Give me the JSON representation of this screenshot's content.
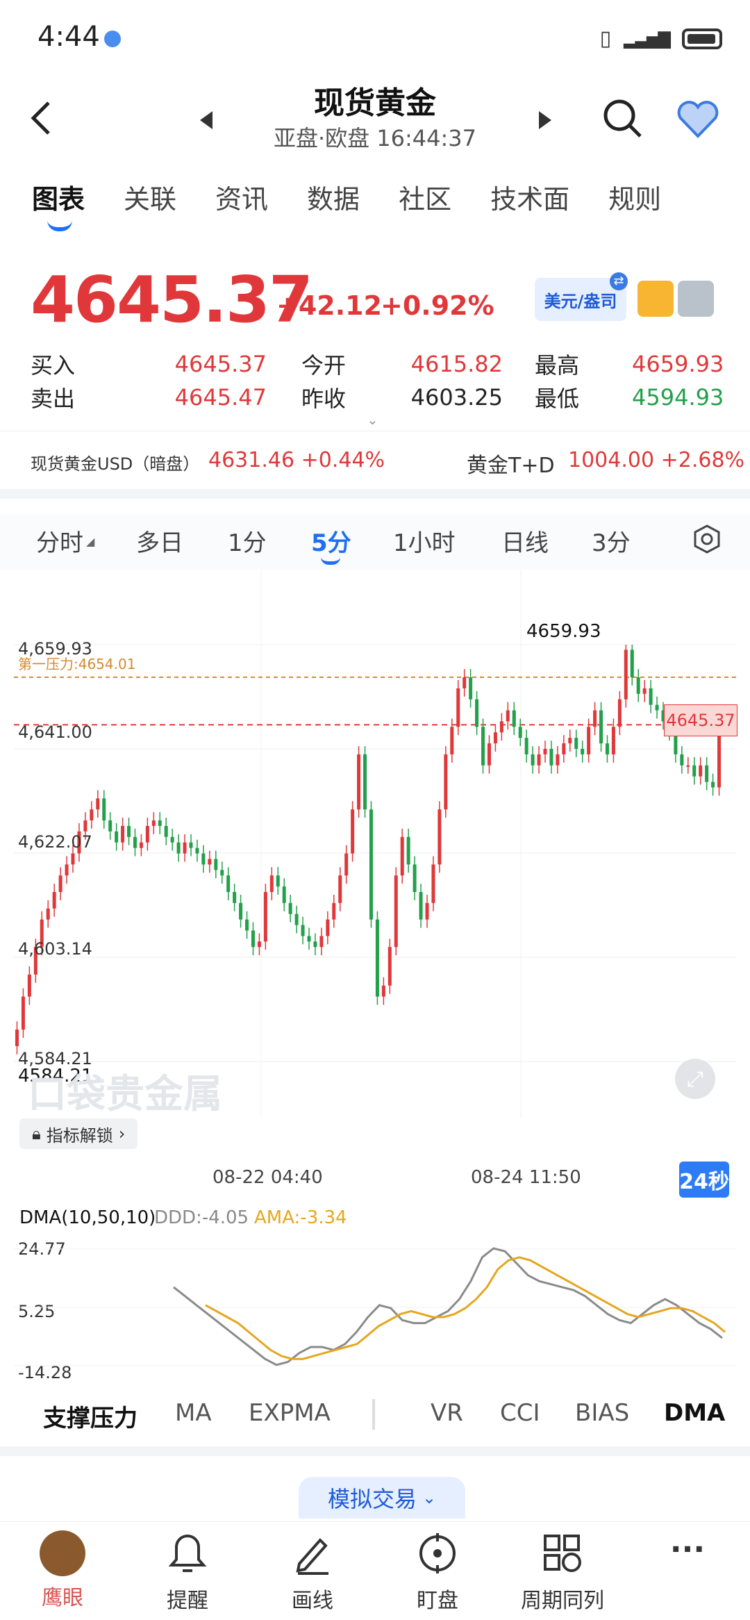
{
  "status": {
    "time": "4:44"
  },
  "header": {
    "title": "现货黄金",
    "subtitle": "亚盘·欧盘   16:44:37"
  },
  "tabs": [
    "图表",
    "关联",
    "资讯",
    "数据",
    "社区",
    "技术面",
    "规则"
  ],
  "quote": {
    "price": "4645.37",
    "change": "+42.12",
    "change_pct": "+0.92%",
    "currency_btn": "美元/盎司",
    "rows": [
      [
        "买入",
        "4645.37",
        "今开",
        "4615.82",
        "最高",
        "4659.93"
      ],
      [
        "卖出",
        "4645.47",
        "昨收",
        "4603.25",
        "最低",
        "4594.93"
      ]
    ]
  },
  "sub_quotes": {
    "left_label": "现货黄金USD（暗盘）",
    "left_value": "4631.46 +0.44%",
    "right_label": "黄金T+D",
    "right_value": "1004.00 +2.68%"
  },
  "periods": [
    "分时",
    "多日",
    "1分",
    "5分",
    "1小时",
    "日线",
    "3分"
  ],
  "active_period": "5分",
  "chart_labels": {
    "y_ticks": [
      "4,659.93",
      "4,641.00",
      "4,622.07",
      "4,603.14",
      "4,584.21"
    ],
    "resistance": "第一压力:4654.01",
    "high_marker": "4659.93",
    "low_marker": "4584.21",
    "current_tag": "4645.37",
    "unlock": "指标解锁",
    "x_ticks": [
      "08-22 04:40",
      "08-24 11:50"
    ],
    "countdown": "24秒",
    "watermark": "口袋贵金属"
  },
  "dma_panel": {
    "title": "DMA(10,50,10)",
    "ddd": "DDD:-4.05",
    "ama": "AMA:-3.34",
    "y_ticks": [
      "24.77",
      "5.25",
      "-14.28"
    ]
  },
  "indicator_tabs": [
    "支撑压力",
    "MA",
    "EXPMA",
    "VR",
    "CCI",
    "BIAS",
    "DMA"
  ],
  "sim_trade": "模拟交易",
  "bottom_nav": [
    "鹰眼",
    "提醒",
    "画线",
    "盯盘",
    "周期同列",
    "···"
  ],
  "colors": {
    "up": "#e0383a",
    "down": "#22a04a",
    "accent": "#1e6ff5"
  },
  "chart_data": {
    "type": "candlestick",
    "ylim": [
      4584.21,
      4659.93
    ],
    "resistance_level": 4654.01,
    "current_price": 4645.37,
    "close_series": [
      4590,
      4596,
      4600,
      4605,
      4610,
      4612,
      4615,
      4618,
      4620,
      4622,
      4626,
      4628,
      4630,
      4632,
      4628,
      4626,
      4624,
      4627,
      4625,
      4623,
      4624,
      4627,
      4628,
      4627,
      4625,
      4624,
      4622,
      4624,
      4623,
      4622,
      4620,
      4621,
      4619,
      4618,
      4615,
      4613,
      4610,
      4608,
      4605,
      4606,
      4615,
      4618,
      4616,
      4613,
      4611,
      4609,
      4607,
      4606,
      4605,
      4607,
      4610,
      4613,
      4618,
      4622,
      4630,
      4640,
      4630,
      4610,
      4596,
      4598,
      4605,
      4618,
      4625,
      4620,
      4615,
      4610,
      4613,
      4620,
      4630,
      4640,
      4645,
      4652,
      4654,
      4650,
      4645,
      4638,
      4642,
      4644,
      4646,
      4648,
      4645,
      4643,
      4640,
      4638,
      4640,
      4641,
      4638,
      4640,
      4642,
      4643,
      4641,
      4640,
      4645,
      4648,
      4642,
      4640,
      4645,
      4650,
      4659,
      4654,
      4651,
      4652,
      4649,
      4648,
      4646,
      4644,
      4640,
      4638,
      4638,
      4636,
      4638,
      4635,
      4634,
      4645
    ],
    "dma_ddd": [
      12,
      9,
      6,
      3,
      0,
      -3,
      -6,
      -9,
      -12,
      -14,
      -13,
      -10,
      -8,
      -8,
      -9,
      -7,
      -3,
      2,
      6,
      5,
      1,
      0,
      0,
      2,
      4,
      8,
      14,
      22,
      25,
      24,
      20,
      16,
      14,
      13,
      12,
      11,
      9,
      6,
      3,
      1,
      0,
      3,
      6,
      8,
      6,
      3,
      0,
      -2,
      -5
    ],
    "dma_ama": [
      6,
      4,
      2,
      0,
      -3,
      -6,
      -9,
      -11,
      -12,
      -12,
      -11,
      -10,
      -9,
      -8,
      -7,
      -4,
      -1,
      1,
      3,
      4,
      3,
      2,
      2,
      3,
      5,
      8,
      12,
      18,
      21,
      22,
      21,
      19,
      17,
      15,
      13,
      11,
      9,
      7,
      5,
      3,
      2,
      3,
      4,
      5,
      5,
      4,
      2,
      0,
      -3
    ]
  }
}
